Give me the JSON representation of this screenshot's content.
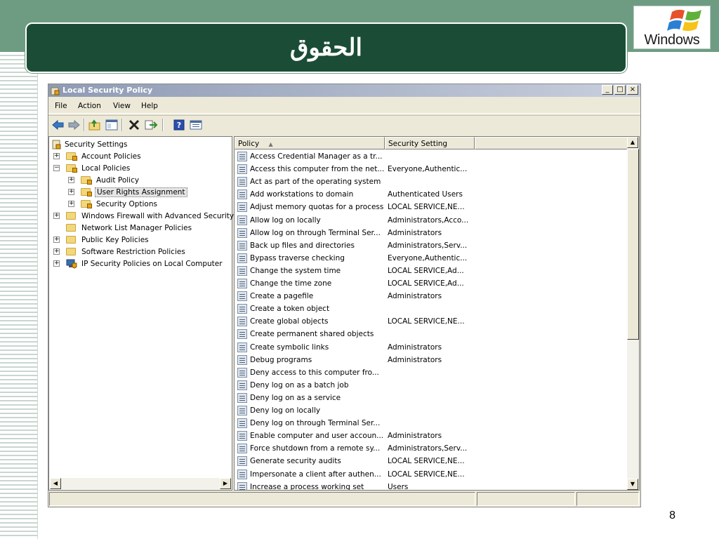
{
  "slide": {
    "title": "الحقوق",
    "logo_text": "Windows",
    "page_number": "8",
    "colors": {
      "band": "#6e9c83",
      "title_bg": "#1b4d36"
    }
  },
  "window": {
    "title": "Local Security Policy",
    "caption_buttons": [
      "_",
      "□",
      "×"
    ],
    "menu": [
      "File",
      "Action",
      "View",
      "Help"
    ],
    "toolbar_icons": [
      "back-arrow-icon",
      "forward-arrow-icon",
      "up-folder-icon",
      "show-hide-tree-icon",
      "delete-icon",
      "export-icon",
      "help-icon",
      "properties-icon"
    ]
  },
  "tree": {
    "items": [
      {
        "label": "Security Settings",
        "expander": "",
        "level": 0
      },
      {
        "label": "Account Policies",
        "expander": "+",
        "level": 1
      },
      {
        "label": "Local Policies",
        "expander": "−",
        "level": 1
      },
      {
        "label": "Audit Policy",
        "expander": "+",
        "level": 2
      },
      {
        "label": "User Rights Assignment",
        "expander": "+",
        "level": 2,
        "selected": true
      },
      {
        "label": "Security Options",
        "expander": "+",
        "level": 2
      },
      {
        "label": "Windows Firewall with Advanced Security",
        "expander": "+",
        "level": 1
      },
      {
        "label": "Network List Manager Policies",
        "expander": "",
        "level": 1
      },
      {
        "label": "Public Key Policies",
        "expander": "+",
        "level": 1
      },
      {
        "label": "Software Restriction Policies",
        "expander": "+",
        "level": 1
      },
      {
        "label": "IP Security Policies on Local Computer",
        "expander": "+",
        "level": 1
      }
    ]
  },
  "list": {
    "columns": [
      "Policy",
      "Security Setting",
      ""
    ],
    "sort_indicator": "▲",
    "rows": [
      {
        "policy": "Access Credential Manager as a tr...",
        "setting": ""
      },
      {
        "policy": "Access this computer from the net...",
        "setting": "Everyone,Authentic..."
      },
      {
        "policy": "Act as part of the operating system",
        "setting": ""
      },
      {
        "policy": "Add workstations to domain",
        "setting": "Authenticated Users"
      },
      {
        "policy": "Adjust memory quotas for a process",
        "setting": "LOCAL SERVICE,NE..."
      },
      {
        "policy": "Allow log on locally",
        "setting": "Administrators,Acco..."
      },
      {
        "policy": "Allow log on through Terminal Ser...",
        "setting": "Administrators"
      },
      {
        "policy": "Back up files and directories",
        "setting": "Administrators,Serv..."
      },
      {
        "policy": "Bypass traverse checking",
        "setting": "Everyone,Authentic..."
      },
      {
        "policy": "Change the system time",
        "setting": "LOCAL SERVICE,Ad..."
      },
      {
        "policy": "Change the time zone",
        "setting": "LOCAL SERVICE,Ad..."
      },
      {
        "policy": "Create a pagefile",
        "setting": "Administrators"
      },
      {
        "policy": "Create a token object",
        "setting": ""
      },
      {
        "policy": "Create global objects",
        "setting": "LOCAL SERVICE,NE..."
      },
      {
        "policy": "Create permanent shared objects",
        "setting": ""
      },
      {
        "policy": "Create symbolic links",
        "setting": "Administrators"
      },
      {
        "policy": "Debug programs",
        "setting": "Administrators"
      },
      {
        "policy": "Deny access to this computer fro...",
        "setting": ""
      },
      {
        "policy": "Deny log on as a batch job",
        "setting": ""
      },
      {
        "policy": "Deny log on as a service",
        "setting": ""
      },
      {
        "policy": "Deny log on locally",
        "setting": ""
      },
      {
        "policy": "Deny log on through Terminal Ser...",
        "setting": ""
      },
      {
        "policy": "Enable computer and user accoun...",
        "setting": "Administrators"
      },
      {
        "policy": "Force shutdown from a remote sy...",
        "setting": "Administrators,Serv..."
      },
      {
        "policy": "Generate security audits",
        "setting": "LOCAL SERVICE,NE..."
      },
      {
        "policy": "Impersonate a client after authen...",
        "setting": "LOCAL SERVICE,NE..."
      },
      {
        "policy": "Increase a process working set",
        "setting": "Users"
      }
    ]
  }
}
